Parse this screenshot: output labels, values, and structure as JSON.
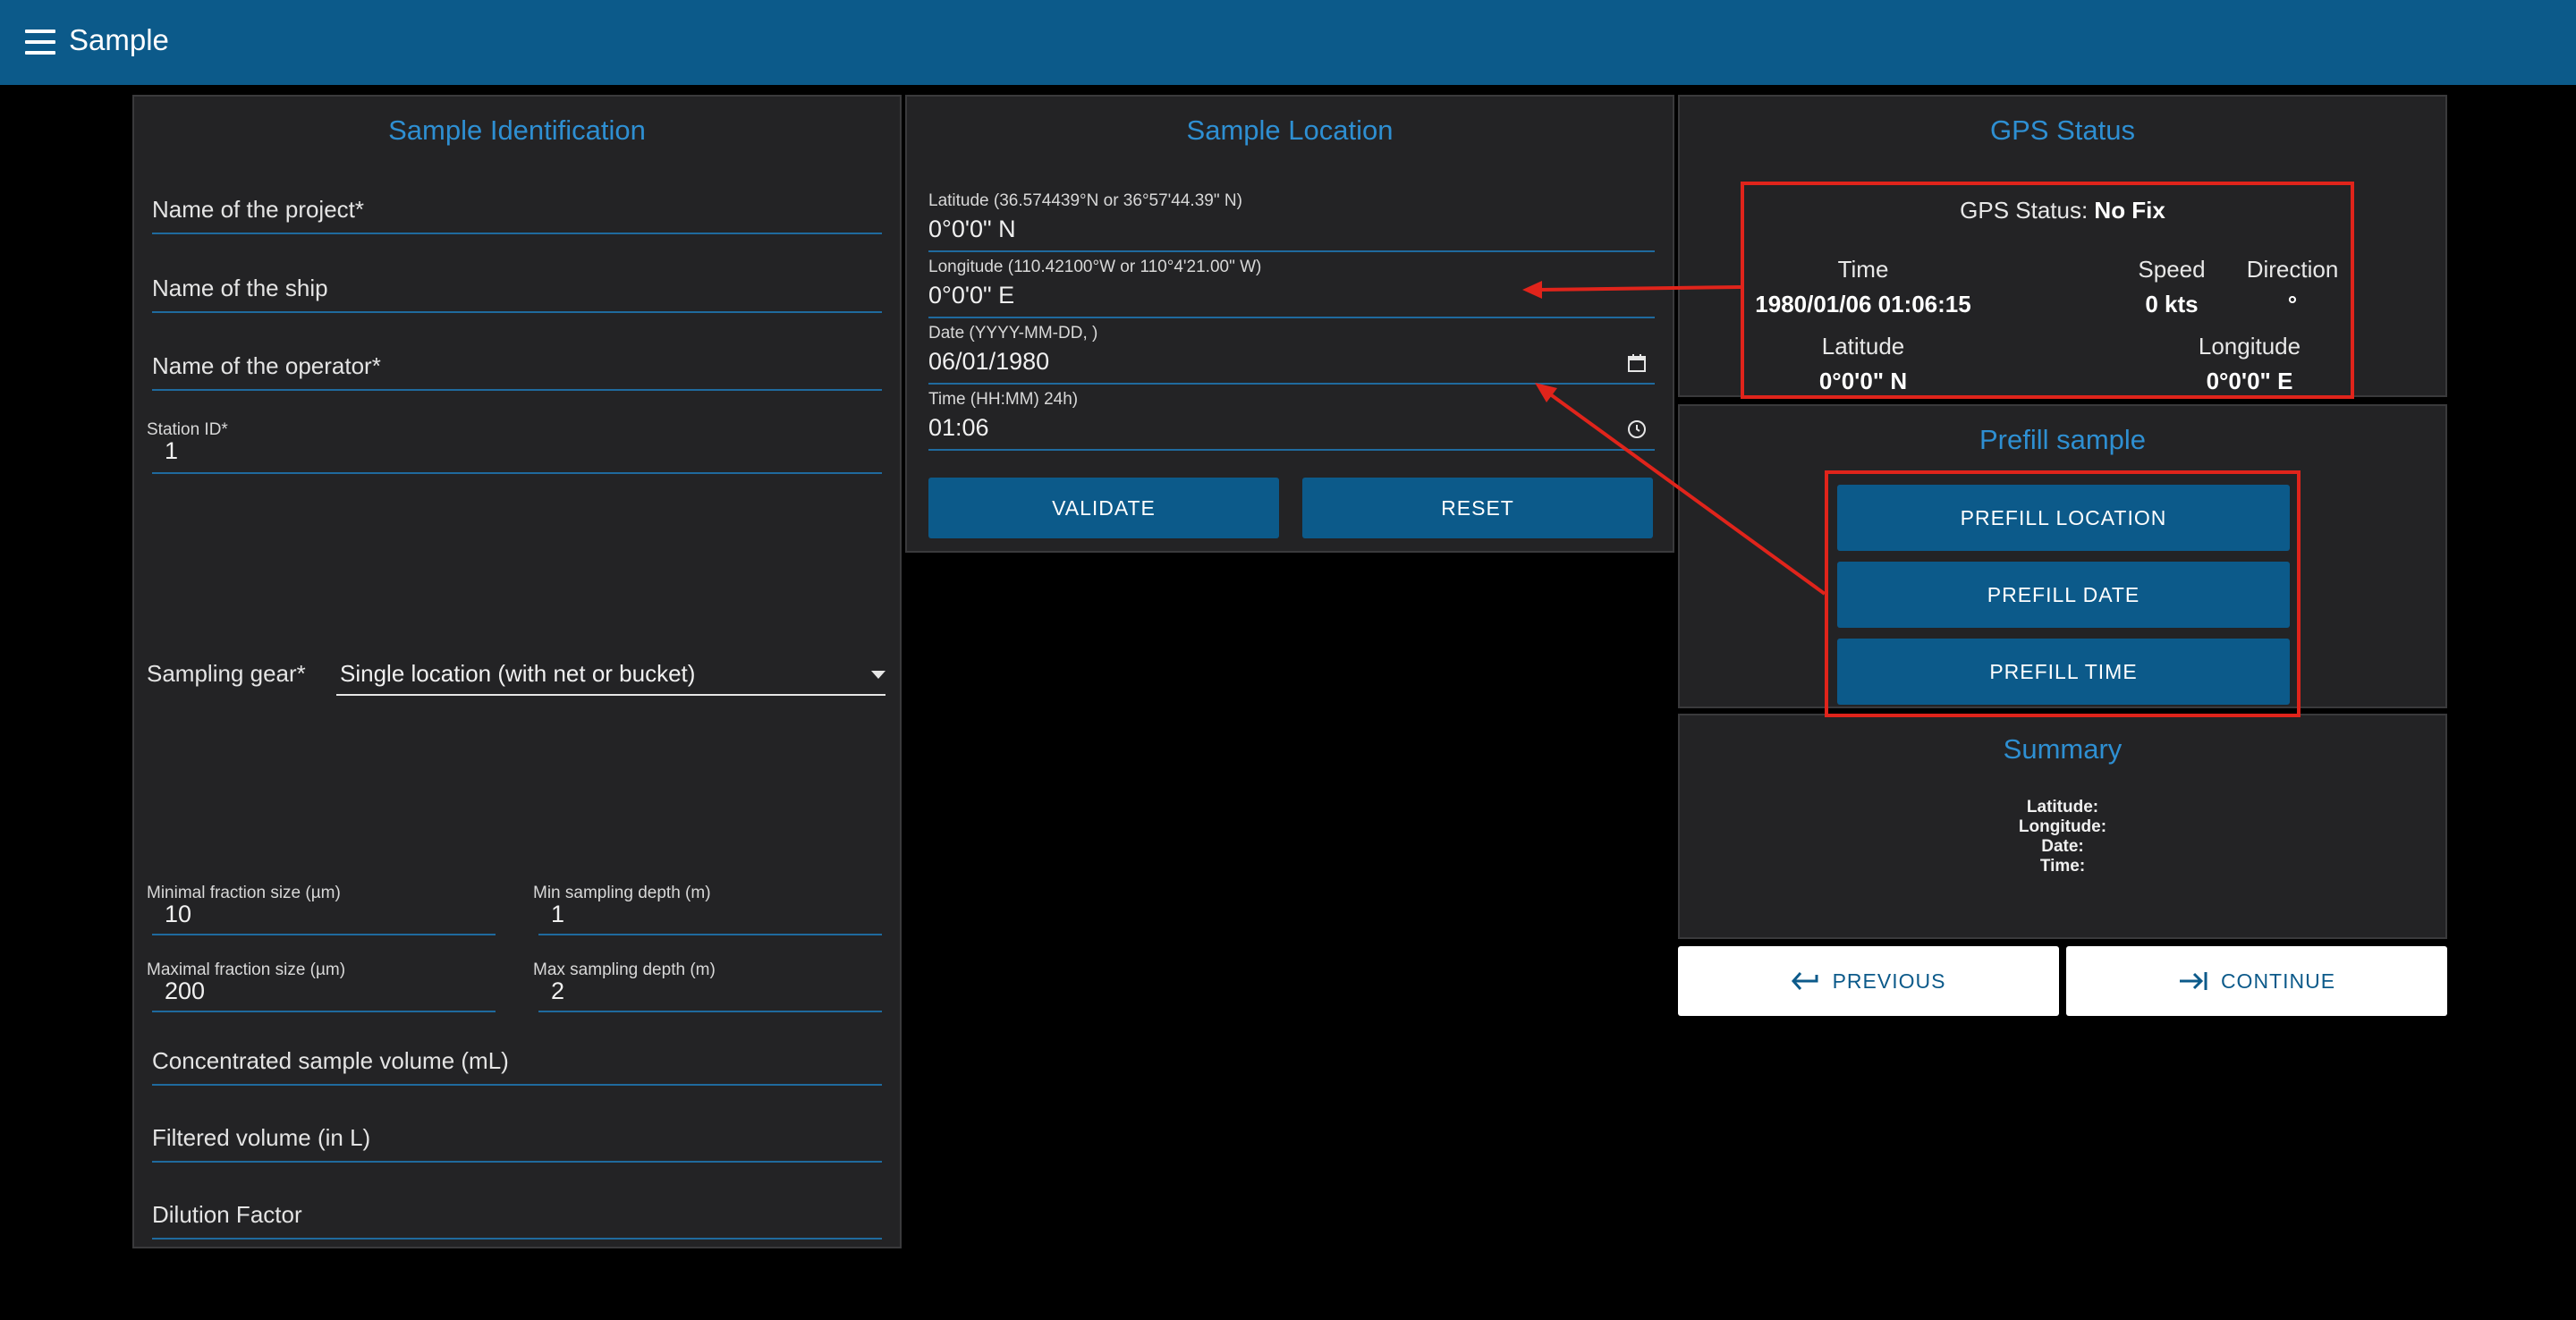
{
  "appbar": {
    "title": "Sample"
  },
  "identification": {
    "title": "Sample Identification",
    "project_placeholder": "Name of the project*",
    "ship_placeholder": "Name of the ship",
    "operator_placeholder": "Name of the operator*",
    "station_label": "Station ID*",
    "station_value": "1",
    "gear_label": "Sampling gear*",
    "gear_value": "Single location (with net or bucket)",
    "min_fraction_label": "Minimal fraction size (µm)",
    "min_fraction_value": "10",
    "min_depth_label": "Min sampling depth (m)",
    "min_depth_value": "1",
    "max_fraction_label": "Maximal fraction size (µm)",
    "max_fraction_value": "200",
    "max_depth_label": "Max sampling depth (m)",
    "max_depth_value": "2",
    "concentrated_placeholder": "Concentrated sample volume (mL)",
    "filtered_placeholder": "Filtered volume (in L)",
    "dilution_placeholder": "Dilution Factor"
  },
  "location": {
    "title": "Sample Location",
    "lat_label": "Latitude (36.574439°N or 36°57'44.39\" N)",
    "lat_value": "0°0'0\" N",
    "lon_label": "Longitude (110.42100°W or 110°4'21.00\" W)",
    "lon_value": "0°0'0\" E",
    "date_label": "Date (YYYY-MM-DD, )",
    "date_value": "06/01/1980",
    "time_label": "Time (HH:MM) 24h)",
    "time_value": "01:06",
    "validate_label": "VALIDATE",
    "reset_label": "RESET"
  },
  "gps": {
    "title": "GPS Status",
    "status_label": "GPS Status: ",
    "status_value": "No Fix",
    "time_label": "Time",
    "time_value": "1980/01/06 01:06:15",
    "speed_label": "Speed",
    "speed_value": "0 kts",
    "direction_label": "Direction",
    "direction_value": "°",
    "lat_label": "Latitude",
    "lat_value": "0°0'0\" N",
    "lon_label": "Longitude",
    "lon_value": "0°0'0\" E"
  },
  "prefill": {
    "title": "Prefill sample",
    "location_label": "PREFILL LOCATION",
    "date_label": "PREFILL DATE",
    "time_label": "PREFILL TIME"
  },
  "summary": {
    "title": "Summary",
    "lat": "Latitude:",
    "lon": "Longitude:",
    "date": "Date:",
    "time": "Time:"
  },
  "nav": {
    "previous_label": "PREVIOUS",
    "continue_label": "CONTINUE"
  },
  "colors": {
    "appbar": "#0c5a8a",
    "accent": "#2e8fd2",
    "annotation": "#e0241b",
    "panel": "#232325"
  },
  "icons": [
    "menu-icon",
    "calendar-icon",
    "clock-icon",
    "dropdown-arrow-icon",
    "arrow-left-icon",
    "arrow-right-to-bar-icon"
  ]
}
